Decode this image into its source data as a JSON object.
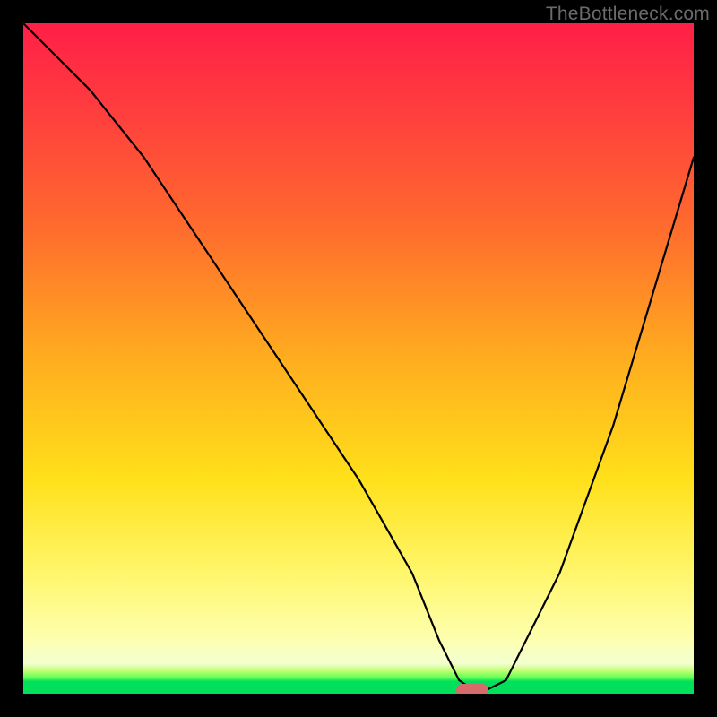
{
  "watermark": {
    "text": "TheBottleneck.com"
  },
  "chart_data": {
    "type": "line",
    "title": "",
    "xlabel": "",
    "ylabel": "",
    "xlim": [
      0,
      100
    ],
    "ylim": [
      0,
      100
    ],
    "grid": false,
    "legend": false,
    "series": [
      {
        "name": "bottleneck-curve",
        "x": [
          0,
          10,
          18,
          30,
          40,
          50,
          58,
          62,
          65,
          68,
          72,
          80,
          88,
          94,
          100
        ],
        "values": [
          100,
          90,
          80,
          62,
          47,
          32,
          18,
          8,
          2,
          0,
          2,
          18,
          40,
          60,
          80
        ]
      }
    ],
    "marker": {
      "x": 67,
      "y": 0.5,
      "color": "#d76b6b"
    },
    "background_gradient": {
      "stops": [
        {
          "pos": 0.0,
          "color": "#ff1f47"
        },
        {
          "pos": 0.3,
          "color": "#ff6a2e"
        },
        {
          "pos": 0.5,
          "color": "#ffad1f"
        },
        {
          "pos": 0.82,
          "color": "#fff66b"
        },
        {
          "pos": 0.96,
          "color": "#c8ff7a"
        },
        {
          "pos": 1.0,
          "color": "#00e05a"
        }
      ]
    }
  }
}
